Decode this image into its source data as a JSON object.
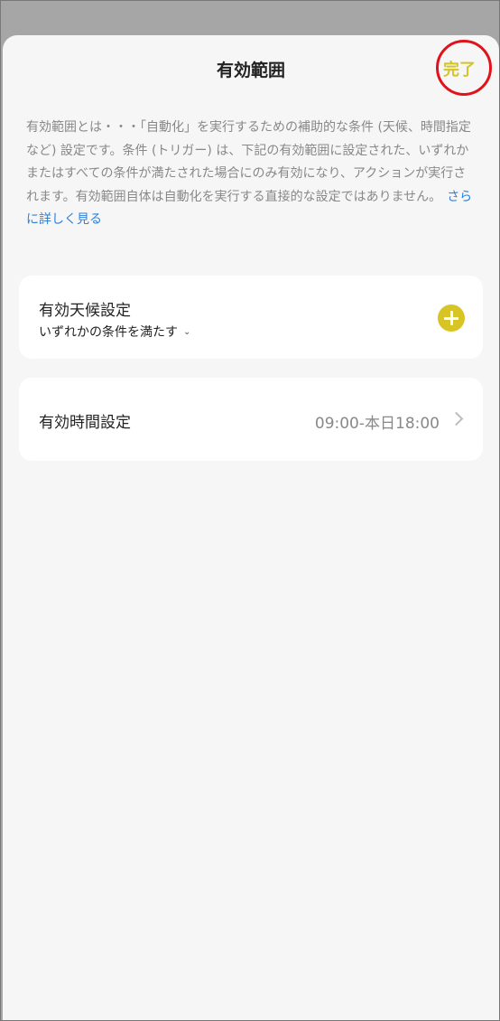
{
  "header": {
    "title": "有効範囲",
    "done_label": "完了"
  },
  "description": {
    "text": "有効範囲とは・・・「自動化」を実行するための補助的な条件 (天候、時間指定など) 設定です。条件 (トリガー) は、下記の有効範囲に設定された、いずれかまたはすべての条件が満たされた場合にのみ有効になり、アクションが実行されます。有効範囲自体は自動化を実行する直接的な設定ではありません。",
    "link": "さらに詳しく見る"
  },
  "weather_card": {
    "label": "有効天候設定",
    "condition": "いずれかの条件を満たす",
    "icons": {
      "add": "plus-circle-icon",
      "dropdown": "chevron-down-icon"
    }
  },
  "time_card": {
    "label": "有効時間設定",
    "value": "09:00-本日18:00",
    "icons": {
      "navigate": "chevron-right-icon"
    }
  },
  "colors": {
    "accent": "#d8c525",
    "link": "#2f80d8",
    "highlight_circle": "#e2121b"
  }
}
